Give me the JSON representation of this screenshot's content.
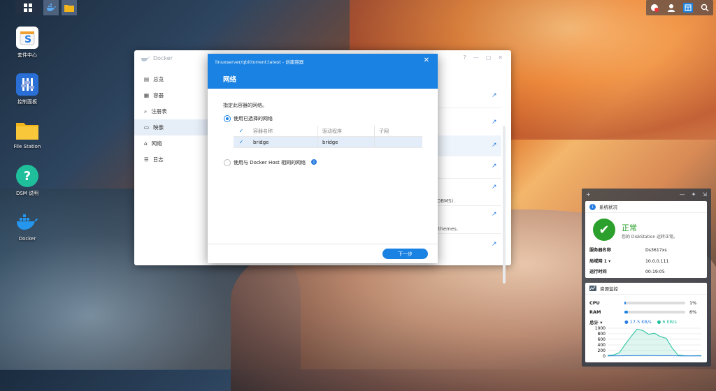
{
  "desktop_icons": [
    {
      "label": "套件中心",
      "icon": "package-center-icon"
    },
    {
      "label": "控制面板",
      "icon": "control-panel-icon"
    },
    {
      "label": "File Station",
      "icon": "folder-icon"
    },
    {
      "label": "DSM 说明",
      "icon": "help-icon"
    },
    {
      "label": "Docker",
      "icon": "docker-icon"
    }
  ],
  "docker_window": {
    "title": "Docker",
    "controls": [
      "?",
      "—",
      "▢",
      "✕"
    ],
    "sidebar": [
      {
        "label": "总览",
        "icon": "overview-icon"
      },
      {
        "label": "容器",
        "icon": "container-icon"
      },
      {
        "label": "注册表",
        "icon": "registry-icon"
      },
      {
        "label": "映像",
        "icon": "image-icon",
        "active": true
      },
      {
        "label": "网络",
        "icon": "network-icon"
      },
      {
        "label": "日志",
        "icon": "log-icon"
      }
    ],
    "fragments": [
      "RDBMS).",
      "d themes."
    ]
  },
  "modal": {
    "title": "linuxserver/qbittorrent:latest - 创建容器",
    "close": "✕",
    "section": "网络",
    "description": "指定此容器的网络。",
    "option_selected": "使用已选择的网络",
    "option_host": "使用与 Docker Host 相同的网络",
    "info": "i",
    "table": {
      "headers": [
        "容器名称",
        "驱动程序",
        "子网"
      ],
      "rows": [
        {
          "name": "bridge",
          "driver": "bridge",
          "subnet": ""
        }
      ]
    },
    "next_label": "下一步"
  },
  "widgets": {
    "panel_controls": [
      "+",
      "—",
      "📌",
      "⇲"
    ],
    "status": {
      "title": "系统状况",
      "state": "正常",
      "message": "您的 DiskStation 运转正常。",
      "rows": [
        {
          "key": "服务器名称",
          "value": "Ds3617xs"
        },
        {
          "key": "局域网 1 ▾",
          "value": "10.0.0.111"
        },
        {
          "key": "运行时间",
          "value": "00:19:05"
        }
      ]
    },
    "resource": {
      "title": "资源监控",
      "cpu_label": "CPU",
      "cpu_value": "1%",
      "cpu_pct": 1,
      "ram_label": "RAM",
      "ram_value": "6%",
      "ram_pct": 6,
      "net_label": "总计 ▾",
      "upload": "17.5 KB/s",
      "download": "6 KB/s",
      "y_ticks": [
        "1000",
        "800",
        "600",
        "400",
        "200",
        "0"
      ],
      "series_up": [
        30,
        40,
        120,
        420,
        700,
        960,
        920,
        780,
        820,
        700,
        640,
        300,
        40,
        20,
        10,
        15,
        20
      ],
      "series_down": [
        5,
        8,
        10,
        12,
        15,
        20,
        22,
        20,
        18,
        16,
        15,
        12,
        8,
        6,
        5,
        5,
        6
      ]
    }
  },
  "colors": {
    "accent": "#1a82e2",
    "ok": "#2ca02c"
  }
}
